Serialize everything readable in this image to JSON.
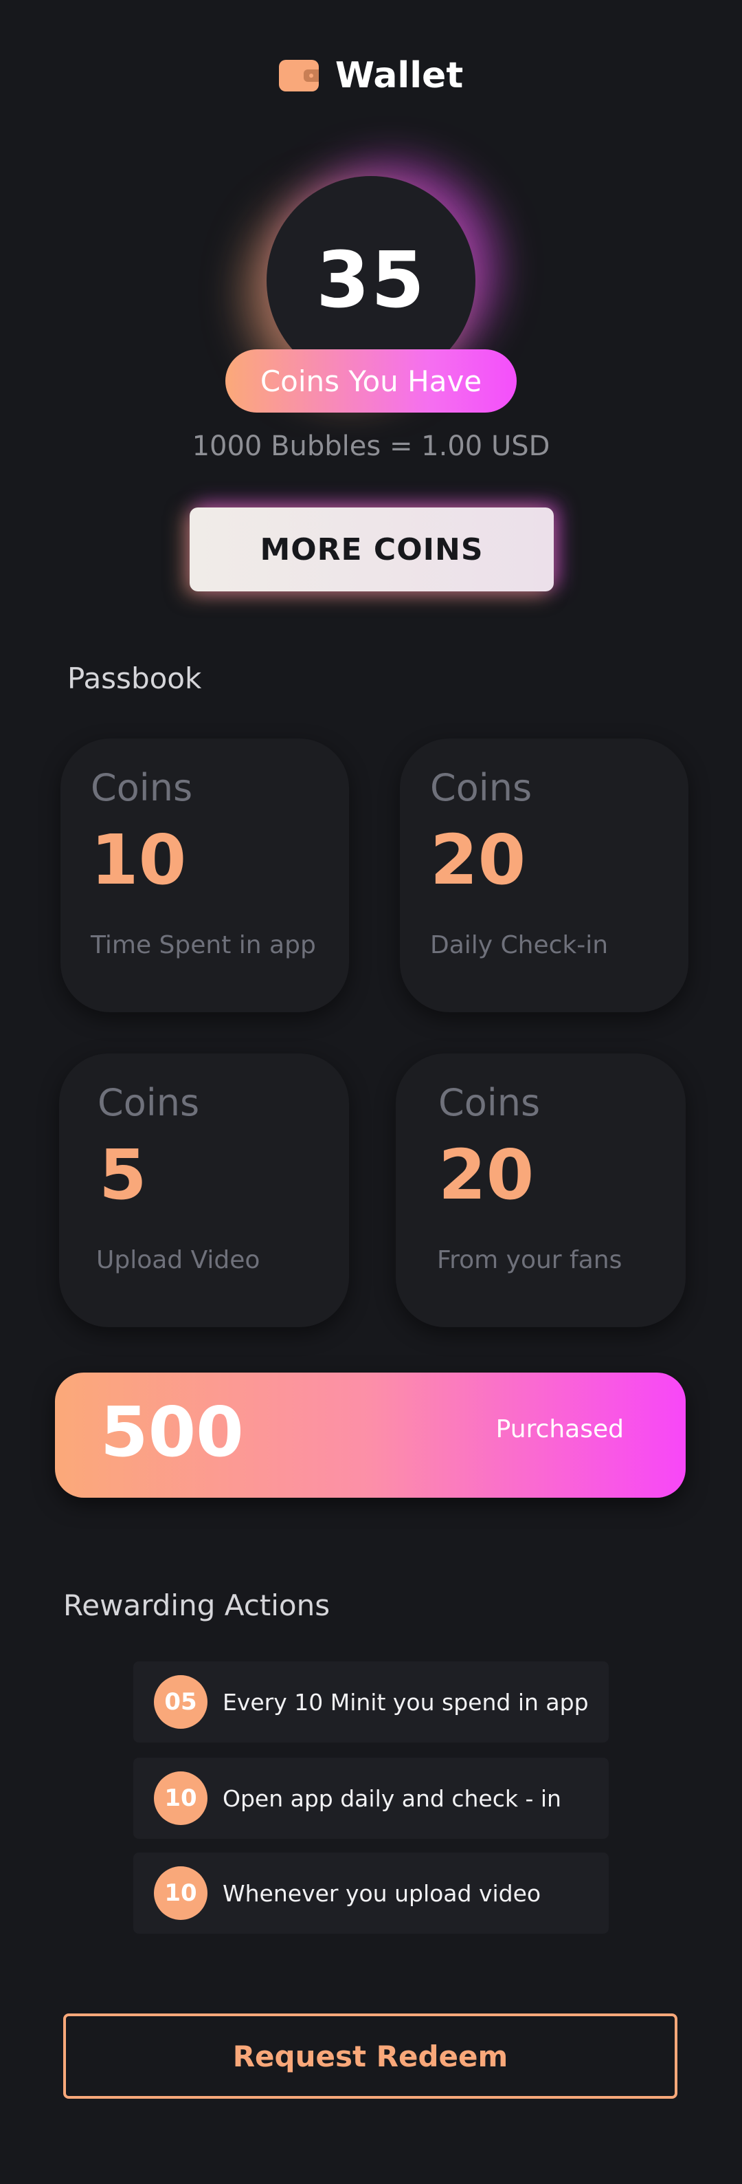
{
  "header": {
    "title": "Wallet",
    "icon": "wallet-icon"
  },
  "balance": {
    "coins": "35",
    "label": "Coins You Have",
    "rate": "1000 Bubbles = 1.00 USD"
  },
  "more_coins_button": "MORE COINS",
  "passbook": {
    "title": "Passbook",
    "cards": [
      {
        "label": "Coins",
        "value": "10",
        "description": "Time Spent in app"
      },
      {
        "label": "Coins",
        "value": "20",
        "description": "Daily Check-in"
      },
      {
        "label": "Coins",
        "value": "5",
        "description": "Upload Video"
      },
      {
        "label": "Coins",
        "value": "20",
        "description": "From your fans"
      }
    ]
  },
  "purchased": {
    "value": "500",
    "label": "Purchased"
  },
  "rewarding_actions": {
    "title": "Rewarding Actions",
    "items": [
      {
        "badge": "05",
        "text": "Every 10 Minit you spend in app"
      },
      {
        "badge": "10",
        "text": "Open app daily and check - in"
      },
      {
        "badge": "10",
        "text": "Whenever you upload video"
      }
    ]
  },
  "redeem_button": "Request Redeem",
  "colors": {
    "background": "#17181c",
    "accent_orange": "#f9a87a",
    "accent_pink": "#f44ffb"
  }
}
